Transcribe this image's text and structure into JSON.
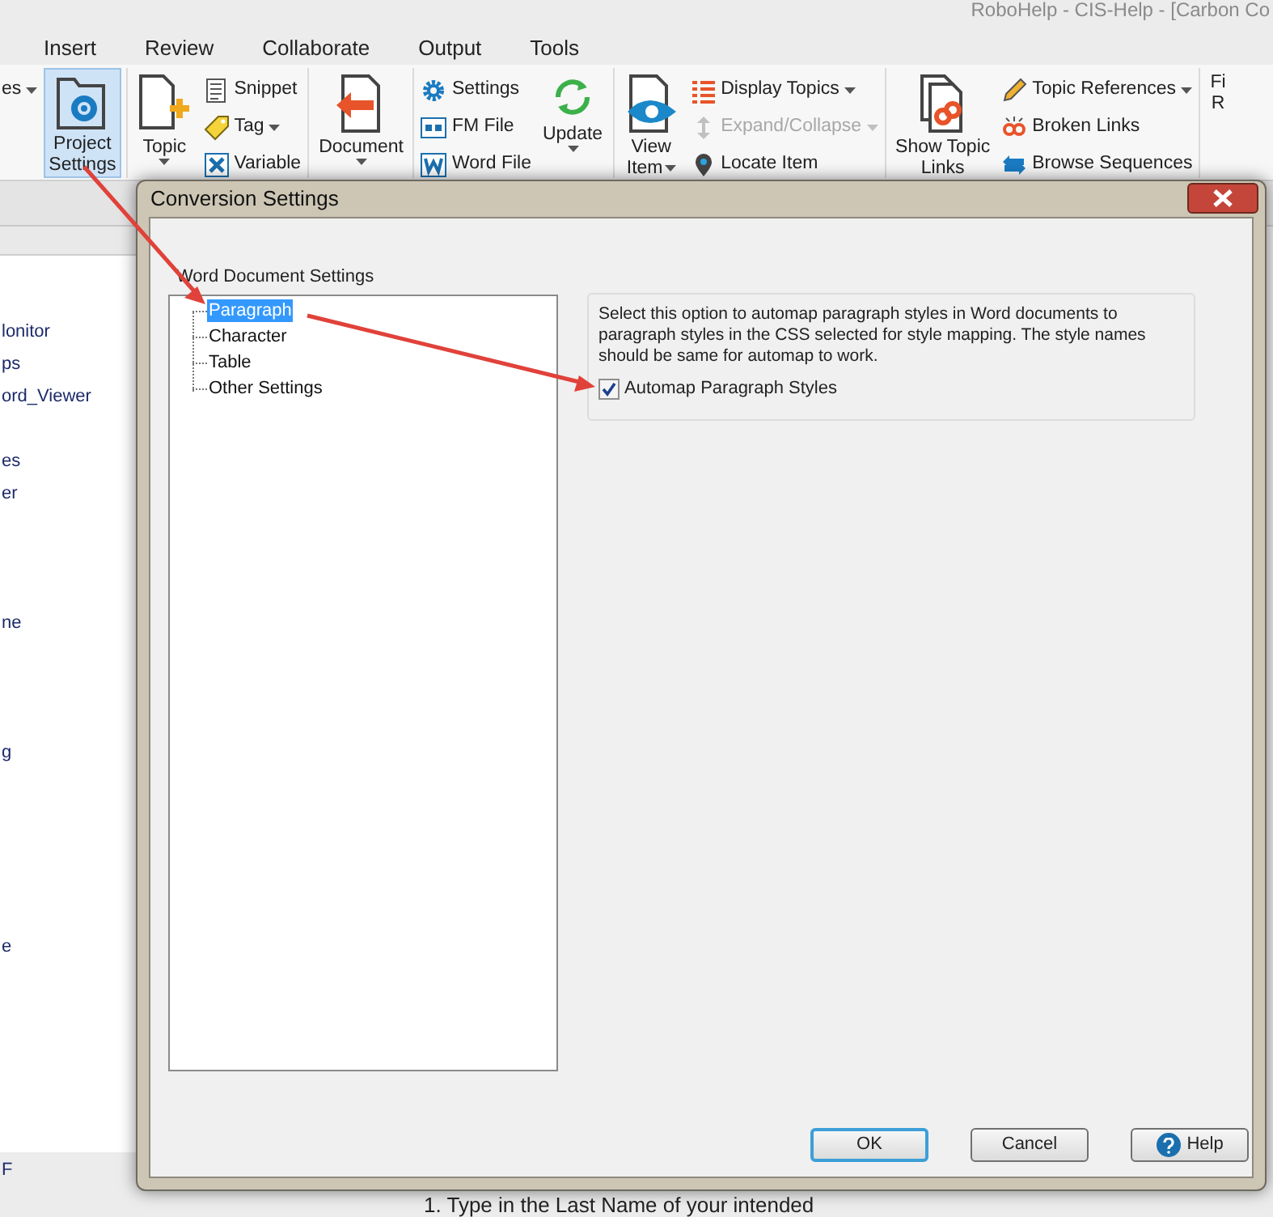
{
  "app_title": "RoboHelp - CIS-Help - [Carbon Co",
  "ribbon_tabs": [
    "Insert",
    "Review",
    "Collaborate",
    "Output",
    "Tools"
  ],
  "ribbon": {
    "groups": [
      {
        "items": [
          {
            "kind": "small",
            "label": "es",
            "dropdown": true,
            "highlighted": false,
            "disabled": false
          },
          {
            "kind": "large",
            "label": "Project Settings",
            "dropdown": false,
            "highlighted": true,
            "disabled": false
          }
        ]
      },
      {
        "items": [
          {
            "kind": "large",
            "label": "Topic",
            "dropdown": true,
            "highlighted": false,
            "disabled": false
          },
          {
            "kind": "small",
            "label": "Snippet",
            "dropdown": false,
            "highlighted": false,
            "disabled": false
          },
          {
            "kind": "small",
            "label": "Tag",
            "dropdown": true,
            "highlighted": false,
            "disabled": false
          },
          {
            "kind": "small",
            "label": "Variable",
            "dropdown": false,
            "highlighted": false,
            "disabled": false
          }
        ]
      },
      {
        "items": [
          {
            "kind": "large",
            "label": "Document",
            "dropdown": true,
            "highlighted": false,
            "disabled": false
          }
        ]
      },
      {
        "items": [
          {
            "kind": "small",
            "label": "Settings",
            "dropdown": false,
            "highlighted": false,
            "disabled": false
          },
          {
            "kind": "small",
            "label": "FM File",
            "dropdown": false,
            "highlighted": false,
            "disabled": false
          },
          {
            "kind": "small",
            "label": "Word File",
            "dropdown": false,
            "highlighted": false,
            "disabled": false
          },
          {
            "kind": "large",
            "label": "Update",
            "dropdown": true,
            "highlighted": false,
            "disabled": false
          }
        ]
      },
      {
        "items": [
          {
            "kind": "large",
            "label": "View Item",
            "dropdown": true,
            "highlighted": false,
            "disabled": false
          },
          {
            "kind": "small",
            "label": "Display Topics",
            "dropdown": true,
            "highlighted": false,
            "disabled": false
          },
          {
            "kind": "small",
            "label": "Expand/Collapse",
            "dropdown": true,
            "highlighted": false,
            "disabled": true
          },
          {
            "kind": "small",
            "label": "Locate Item",
            "dropdown": false,
            "highlighted": false,
            "disabled": false
          }
        ]
      },
      {
        "items": [
          {
            "kind": "large",
            "label": "Show Topic Links",
            "dropdown": false,
            "highlighted": false,
            "disabled": false
          },
          {
            "kind": "small",
            "label": "Topic References",
            "dropdown": true,
            "highlighted": false,
            "disabled": false
          },
          {
            "kind": "small",
            "label": "Broken Links",
            "dropdown": false,
            "highlighted": false,
            "disabled": false
          },
          {
            "kind": "small",
            "label": "Browse Sequences",
            "dropdown": false,
            "highlighted": false,
            "disabled": false
          }
        ]
      },
      {
        "items": [
          {
            "kind": "large",
            "label": "Fi R",
            "dropdown": false,
            "highlighted": false,
            "disabled": false
          }
        ]
      }
    ]
  },
  "project_pane": {
    "items": [
      "lonitor",
      "ps",
      "ord_Viewer",
      "es",
      "er",
      "ne",
      "g",
      "e",
      "F"
    ]
  },
  "document_text": "1.  Type in the Last Name of your intended",
  "dialog": {
    "title": "Conversion Settings",
    "tree_label": "Word Document Settings",
    "tree": [
      {
        "label": "Paragraph",
        "selected": true
      },
      {
        "label": "Character",
        "selected": false
      },
      {
        "label": "Table",
        "selected": false
      },
      {
        "label": "Other Settings",
        "selected": false
      }
    ],
    "description": "Select this option to automap paragraph styles in Word documents to paragraph styles in the CSS selected for style mapping. The style names should be same for automap to work.",
    "checkbox": {
      "label": "Automap Paragraph Styles",
      "checked": true
    },
    "buttons": [
      {
        "label": "OK",
        "kind": "default"
      },
      {
        "label": "Cancel",
        "kind": "normal"
      },
      {
        "label": "Help",
        "kind": "help"
      }
    ]
  }
}
